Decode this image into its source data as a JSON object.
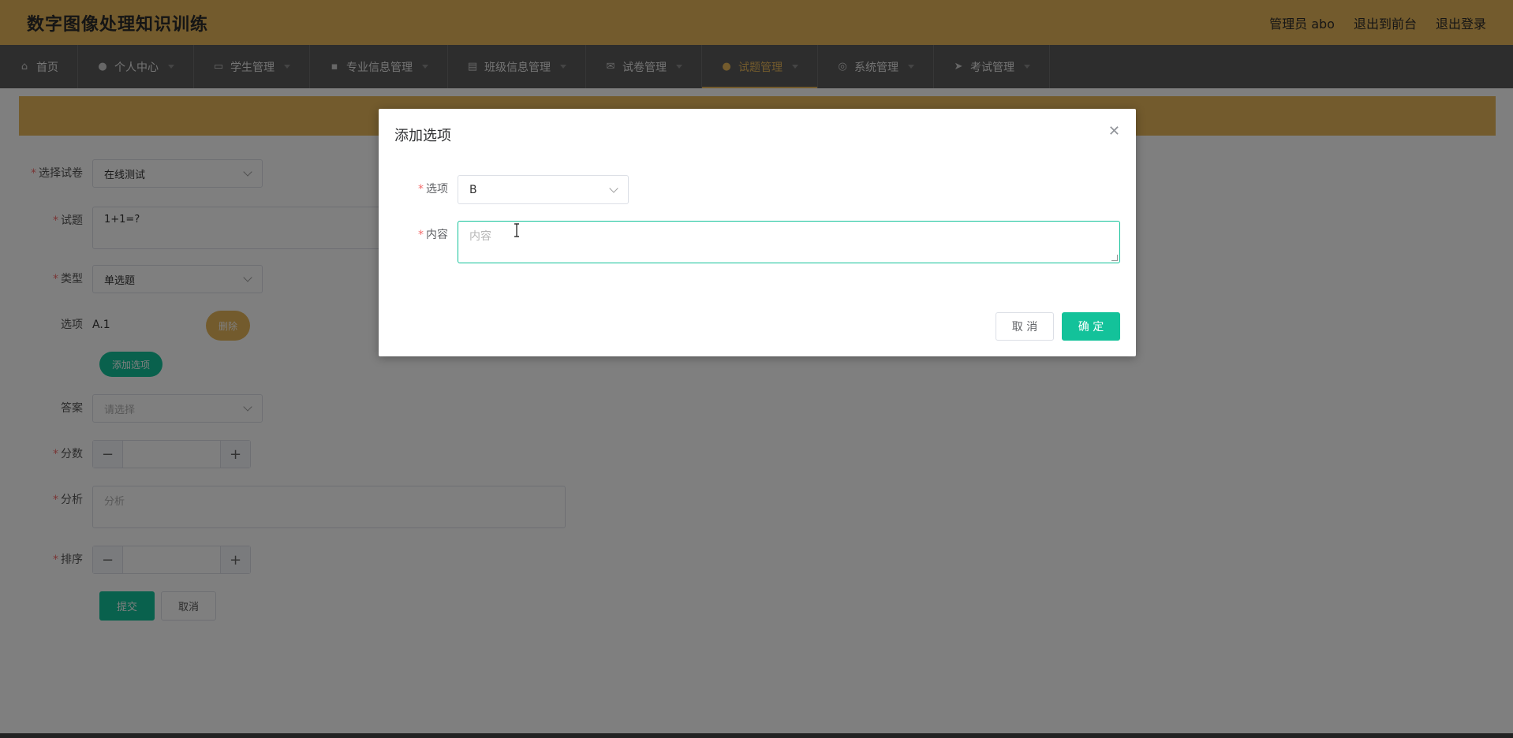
{
  "header": {
    "title": "数字图像处理知识训练",
    "admin_label": "管理员 abo",
    "back_frontend": "退出到前台",
    "logout": "退出登录"
  },
  "nav": {
    "items": [
      {
        "label": "首页",
        "icon": "home-icon"
      },
      {
        "label": "个人中心",
        "icon": "user-icon"
      },
      {
        "label": "学生管理",
        "icon": "monitor-icon"
      },
      {
        "label": "专业信息管理",
        "icon": "chat-icon"
      },
      {
        "label": "班级信息管理",
        "icon": "clipboard-icon"
      },
      {
        "label": "试卷管理",
        "icon": "mail-icon"
      },
      {
        "label": "试题管理",
        "icon": "user-icon"
      },
      {
        "label": "系统管理",
        "icon": "compass-icon"
      },
      {
        "label": "考试管理",
        "icon": "send-icon"
      }
    ],
    "active_index": 6
  },
  "form": {
    "paper_label": "选择试卷",
    "paper_value": "在线测试",
    "question_label": "试题",
    "question_value": "1+1=?",
    "type_label": "类型",
    "type_value": "单选题",
    "options_label": "选项",
    "option_a": "A.1",
    "delete_btn": "删除",
    "add_option_btn": "添加选项",
    "answer_label": "答案",
    "answer_placeholder": "请选择",
    "score_label": "分数",
    "analysis_label": "分析",
    "analysis_placeholder": "分析",
    "order_label": "排序",
    "submit_btn": "提交",
    "cancel_btn": "取消"
  },
  "dialog": {
    "title": "添加选项",
    "option_label": "选项",
    "option_value": "B",
    "content_label": "内容",
    "content_placeholder": "内容",
    "cancel_btn": "取 消",
    "ok_btn": "确 定"
  },
  "colors": {
    "accent_gold": "#e6b65a",
    "accent_green": "#13c29a",
    "nav_bg": "#5a5a5a"
  }
}
